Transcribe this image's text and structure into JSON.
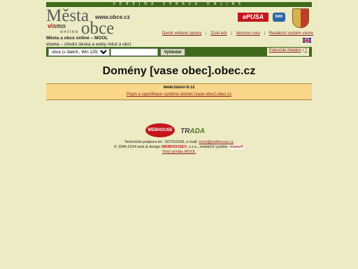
{
  "header": {
    "banner": "VEŘEJNÁ SPRÁVA ONLINE",
    "logo_line1": "Města",
    "logo_line2": "obce",
    "logo_vismo_a": "vis",
    "logo_vismo_b": "mo",
    "logo_online": "online",
    "logo_url": "www.obce.cz",
    "tagline_1": "Města a obce online – MOOL",
    "tagline_2_vis": "vis",
    "tagline_2_mo": "mo",
    "tagline_2_rest": " – úřední deska a weby měst a obcí",
    "badge_epusa": "ePUSA",
    "badge_smo": "SMO"
  },
  "nav": {
    "items": [
      {
        "label": "Deník veřejné správy"
      },
      {
        "label": "Získí erb"
      },
      {
        "label": "Vesnice roku"
      },
      {
        "label": "Redakční systém vismo"
      }
    ]
  },
  "search": {
    "select_value": "obce (s diakrit., Win 1250)",
    "input_value": "",
    "button_label": "Vyhledat",
    "advanced_label": "Pokročilé hledání",
    "help_label": "?"
  },
  "main": {
    "title": "Domény [vase obec].obec.cz",
    "domain": "www.tasov-tr.cz",
    "spec_link": "Popis a specifikace systému domén [vase obec].obec.cz"
  },
  "footer": {
    "logo_webhouse": "WEBHOUSE",
    "logo_trada_a": "TR",
    "logo_trada_b": "ADA",
    "line1": "Technická podpora tel.: 567310166, e-mail: ",
    "email": "mool@webhouse.cz",
    "line2_a": "© 1996-2014 web & design ",
    "line2_wh": "WEBHOUSE®",
    "line2_b": ", s.r.o., redakční systém ",
    "line2_vs": "vismo®",
    "line3": "Tiráž portálu MOOL"
  },
  "colors": {
    "background": "#ecebc4",
    "bar": "#3f6a1c",
    "accent_red": "#c4161c",
    "panel": "#f9d68a"
  }
}
